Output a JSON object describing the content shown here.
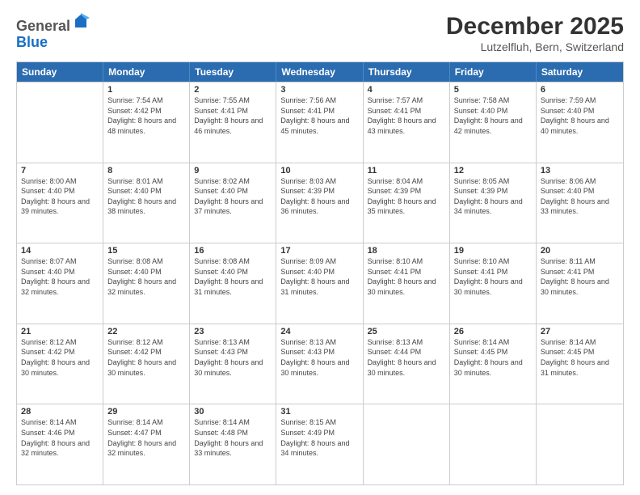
{
  "header": {
    "logo_general": "General",
    "logo_blue": "Blue",
    "month_title": "December 2025",
    "location": "Lutzelfluh, Bern, Switzerland"
  },
  "weekdays": [
    "Sunday",
    "Monday",
    "Tuesday",
    "Wednesday",
    "Thursday",
    "Friday",
    "Saturday"
  ],
  "rows": [
    [
      {
        "day": "",
        "sunrise": "",
        "sunset": "",
        "daylight": ""
      },
      {
        "day": "1",
        "sunrise": "7:54 AM",
        "sunset": "4:42 PM",
        "daylight": "8 hours and 48 minutes."
      },
      {
        "day": "2",
        "sunrise": "7:55 AM",
        "sunset": "4:41 PM",
        "daylight": "8 hours and 46 minutes."
      },
      {
        "day": "3",
        "sunrise": "7:56 AM",
        "sunset": "4:41 PM",
        "daylight": "8 hours and 45 minutes."
      },
      {
        "day": "4",
        "sunrise": "7:57 AM",
        "sunset": "4:41 PM",
        "daylight": "8 hours and 43 minutes."
      },
      {
        "day": "5",
        "sunrise": "7:58 AM",
        "sunset": "4:40 PM",
        "daylight": "8 hours and 42 minutes."
      },
      {
        "day": "6",
        "sunrise": "7:59 AM",
        "sunset": "4:40 PM",
        "daylight": "8 hours and 40 minutes."
      }
    ],
    [
      {
        "day": "7",
        "sunrise": "8:00 AM",
        "sunset": "4:40 PM",
        "daylight": "8 hours and 39 minutes."
      },
      {
        "day": "8",
        "sunrise": "8:01 AM",
        "sunset": "4:40 PM",
        "daylight": "8 hours and 38 minutes."
      },
      {
        "day": "9",
        "sunrise": "8:02 AM",
        "sunset": "4:40 PM",
        "daylight": "8 hours and 37 minutes."
      },
      {
        "day": "10",
        "sunrise": "8:03 AM",
        "sunset": "4:39 PM",
        "daylight": "8 hours and 36 minutes."
      },
      {
        "day": "11",
        "sunrise": "8:04 AM",
        "sunset": "4:39 PM",
        "daylight": "8 hours and 35 minutes."
      },
      {
        "day": "12",
        "sunrise": "8:05 AM",
        "sunset": "4:39 PM",
        "daylight": "8 hours and 34 minutes."
      },
      {
        "day": "13",
        "sunrise": "8:06 AM",
        "sunset": "4:40 PM",
        "daylight": "8 hours and 33 minutes."
      }
    ],
    [
      {
        "day": "14",
        "sunrise": "8:07 AM",
        "sunset": "4:40 PM",
        "daylight": "8 hours and 32 minutes."
      },
      {
        "day": "15",
        "sunrise": "8:08 AM",
        "sunset": "4:40 PM",
        "daylight": "8 hours and 32 minutes."
      },
      {
        "day": "16",
        "sunrise": "8:08 AM",
        "sunset": "4:40 PM",
        "daylight": "8 hours and 31 minutes."
      },
      {
        "day": "17",
        "sunrise": "8:09 AM",
        "sunset": "4:40 PM",
        "daylight": "8 hours and 31 minutes."
      },
      {
        "day": "18",
        "sunrise": "8:10 AM",
        "sunset": "4:41 PM",
        "daylight": "8 hours and 30 minutes."
      },
      {
        "day": "19",
        "sunrise": "8:10 AM",
        "sunset": "4:41 PM",
        "daylight": "8 hours and 30 minutes."
      },
      {
        "day": "20",
        "sunrise": "8:11 AM",
        "sunset": "4:41 PM",
        "daylight": "8 hours and 30 minutes."
      }
    ],
    [
      {
        "day": "21",
        "sunrise": "8:12 AM",
        "sunset": "4:42 PM",
        "daylight": "8 hours and 30 minutes."
      },
      {
        "day": "22",
        "sunrise": "8:12 AM",
        "sunset": "4:42 PM",
        "daylight": "8 hours and 30 minutes."
      },
      {
        "day": "23",
        "sunrise": "8:13 AM",
        "sunset": "4:43 PM",
        "daylight": "8 hours and 30 minutes."
      },
      {
        "day": "24",
        "sunrise": "8:13 AM",
        "sunset": "4:43 PM",
        "daylight": "8 hours and 30 minutes."
      },
      {
        "day": "25",
        "sunrise": "8:13 AM",
        "sunset": "4:44 PM",
        "daylight": "8 hours and 30 minutes."
      },
      {
        "day": "26",
        "sunrise": "8:14 AM",
        "sunset": "4:45 PM",
        "daylight": "8 hours and 30 minutes."
      },
      {
        "day": "27",
        "sunrise": "8:14 AM",
        "sunset": "4:45 PM",
        "daylight": "8 hours and 31 minutes."
      }
    ],
    [
      {
        "day": "28",
        "sunrise": "8:14 AM",
        "sunset": "4:46 PM",
        "daylight": "8 hours and 32 minutes."
      },
      {
        "day": "29",
        "sunrise": "8:14 AM",
        "sunset": "4:47 PM",
        "daylight": "8 hours and 32 minutes."
      },
      {
        "day": "30",
        "sunrise": "8:14 AM",
        "sunset": "4:48 PM",
        "daylight": "8 hours and 33 minutes."
      },
      {
        "day": "31",
        "sunrise": "8:15 AM",
        "sunset": "4:49 PM",
        "daylight": "8 hours and 34 minutes."
      },
      {
        "day": "",
        "sunrise": "",
        "sunset": "",
        "daylight": ""
      },
      {
        "day": "",
        "sunrise": "",
        "sunset": "",
        "daylight": ""
      },
      {
        "day": "",
        "sunrise": "",
        "sunset": "",
        "daylight": ""
      }
    ]
  ]
}
